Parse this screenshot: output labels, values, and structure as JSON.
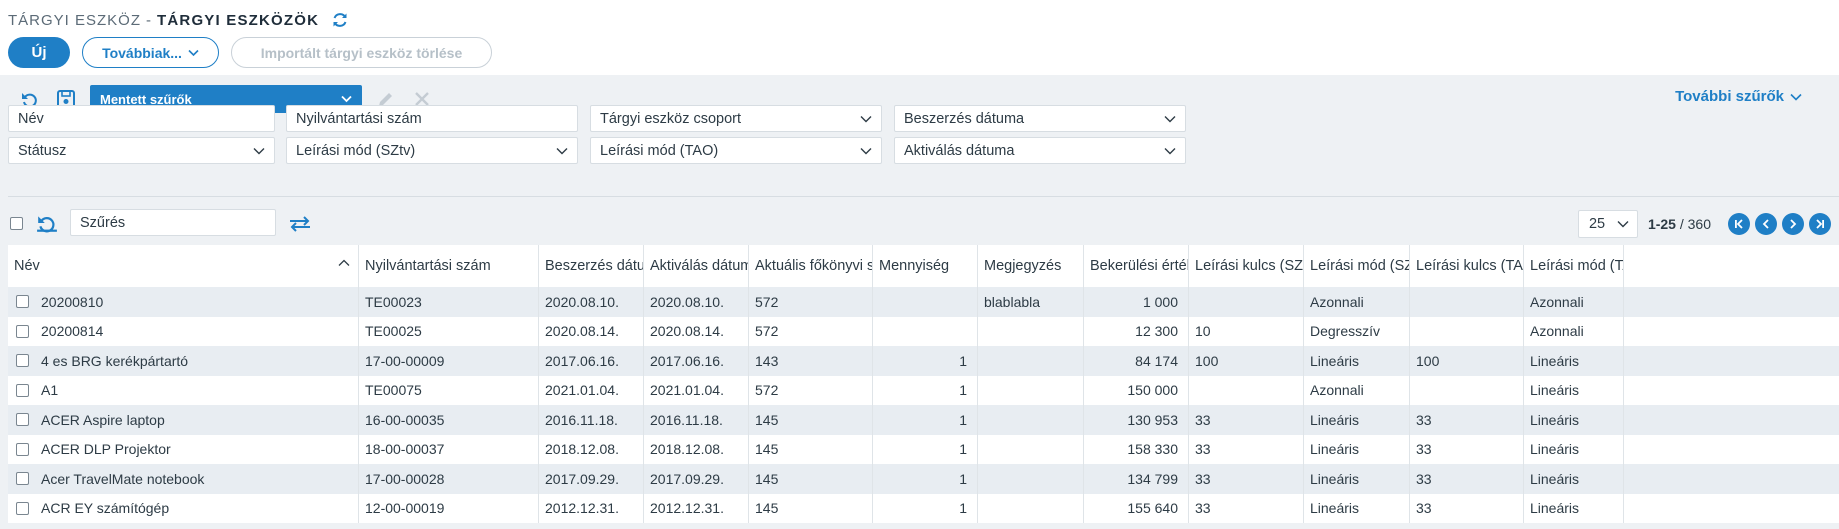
{
  "header": {
    "breadcrumb": "TÁRGYI ESZKÖZ",
    "separator": "-",
    "title": "TÁRGYI ESZKÖZÖK",
    "buttons": {
      "new_label": "Új",
      "more_label": "Továbbiak...",
      "delete_imported_label": "Importált tárgyi eszköz törlése"
    }
  },
  "filters": {
    "saved_filters_label": "Mentett szűrők",
    "more_filters_label": "További szűrők",
    "fields": {
      "name": "Név",
      "reg_number": "Nyilvántartási szám",
      "asset_group": "Tárgyi eszköz csoport",
      "purchase_date": "Beszerzés dátuma",
      "status": "Státusz",
      "depr_method_sztv": "Leírási mód (SZtv)",
      "depr_method_tao": "Leírási mód (TAO)",
      "activation_date": "Aktiválás dátuma"
    }
  },
  "list": {
    "search_placeholder": "Szűrés",
    "page_size": "25",
    "page_range": "1-25",
    "page_total": " / 360"
  },
  "colors": {
    "accent": "#1f7fc6",
    "row_alt": "#e8edf2",
    "filter_bg": "#eef1f4"
  },
  "table": {
    "columns": [
      "Név",
      "Nyilvántartási szám",
      "Beszerzés dátuma",
      "Aktiválás dátuma",
      "Aktuális főkönyvi szám",
      "Mennyiség",
      "Megjegyzés",
      "Bekerülési érték",
      "Leírási kulcs (SZtv)",
      "Leírási mód (SZtv)",
      "Leírási kulcs (TAO)",
      "Leírási mód (TAO)"
    ],
    "rows": [
      [
        "20200810",
        "TE00023",
        "2020.08.10.",
        "2020.08.10.",
        "572",
        "",
        "blablabla",
        "1 000",
        "",
        "Azonnali",
        "",
        "Azonnali"
      ],
      [
        "20200814",
        "TE00025",
        "2020.08.14.",
        "2020.08.14.",
        "572",
        "",
        "",
        "12 300",
        "10",
        "Degresszív",
        "",
        "Azonnali"
      ],
      [
        "4 es BRG kerékpártartó",
        "17-00-00009",
        "2017.06.16.",
        "2017.06.16.",
        "143",
        "1",
        "",
        "84 174",
        "100",
        "Lineáris",
        "100",
        "Lineáris"
      ],
      [
        "A1",
        "TE00075",
        "2021.01.04.",
        "2021.01.04.",
        "572",
        "1",
        "",
        "150 000",
        "",
        "Azonnali",
        "",
        "Lineáris"
      ],
      [
        "ACER Aspire laptop",
        "16-00-00035",
        "2016.11.18.",
        "2016.11.18.",
        "145",
        "1",
        "",
        "130 953",
        "33",
        "Lineáris",
        "33",
        "Lineáris"
      ],
      [
        "ACER DLP Projektor",
        "18-00-00037",
        "2018.12.08.",
        "2018.12.08.",
        "145",
        "1",
        "",
        "158 330",
        "33",
        "Lineáris",
        "33",
        "Lineáris"
      ],
      [
        "Acer TravelMate notebook",
        "17-00-00028",
        "2017.09.29.",
        "2017.09.29.",
        "145",
        "1",
        "",
        "134 799",
        "33",
        "Lineáris",
        "33",
        "Lineáris"
      ],
      [
        "ACR EY számítógép",
        "12-00-00019",
        "2012.12.31.",
        "2012.12.31.",
        "145",
        "1",
        "",
        "155 640",
        "33",
        "Lineáris",
        "33",
        "Lineáris"
      ]
    ]
  }
}
